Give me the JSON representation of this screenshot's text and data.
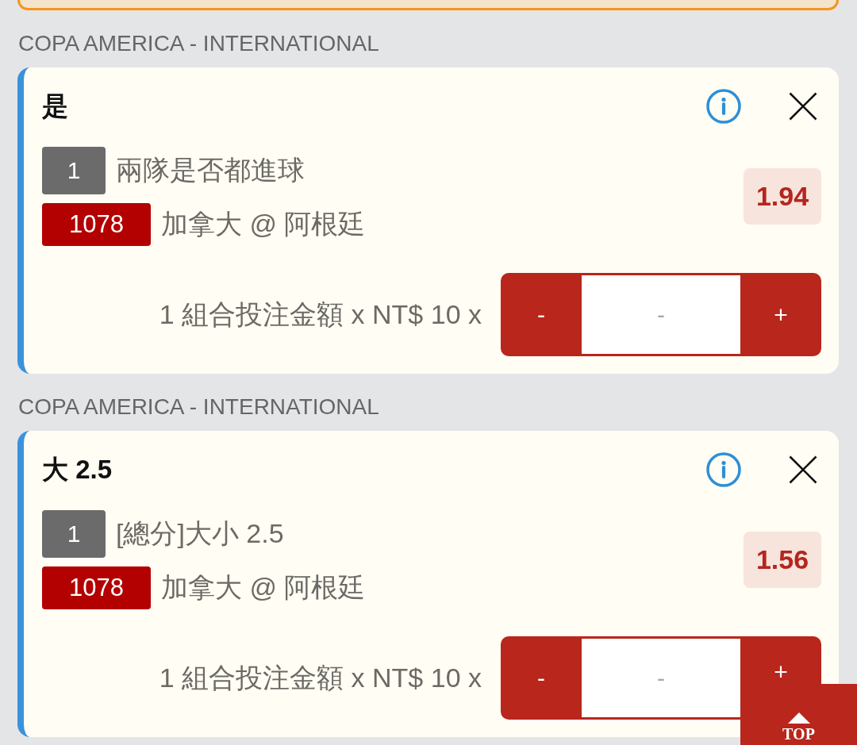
{
  "sections": [
    {
      "league": "COPA AMERICA - INTERNATIONAL",
      "bet": {
        "selection": "是",
        "bet_count": "1",
        "market": "兩隊是否都進球",
        "match_code": "1078",
        "match": "加拿大 @ 阿根廷",
        "odds": "1.94",
        "stake_label": "1 組合投注金額 x NT$ 10 x",
        "stepper": {
          "minus": "-",
          "placeholder": "-",
          "plus": "+"
        }
      }
    },
    {
      "league": "COPA AMERICA - INTERNATIONAL",
      "bet": {
        "selection": "大 2.5",
        "bet_count": "1",
        "market": "[總分]大小 2.5",
        "match_code": "1078",
        "match": "加拿大 @ 阿根廷",
        "odds": "1.56",
        "stake_label": "1 組合投注金額 x NT$ 10 x",
        "stepper": {
          "minus": "-",
          "placeholder": "-",
          "plus": "+"
        }
      }
    }
  ],
  "top_button": {
    "label": "TOP"
  }
}
